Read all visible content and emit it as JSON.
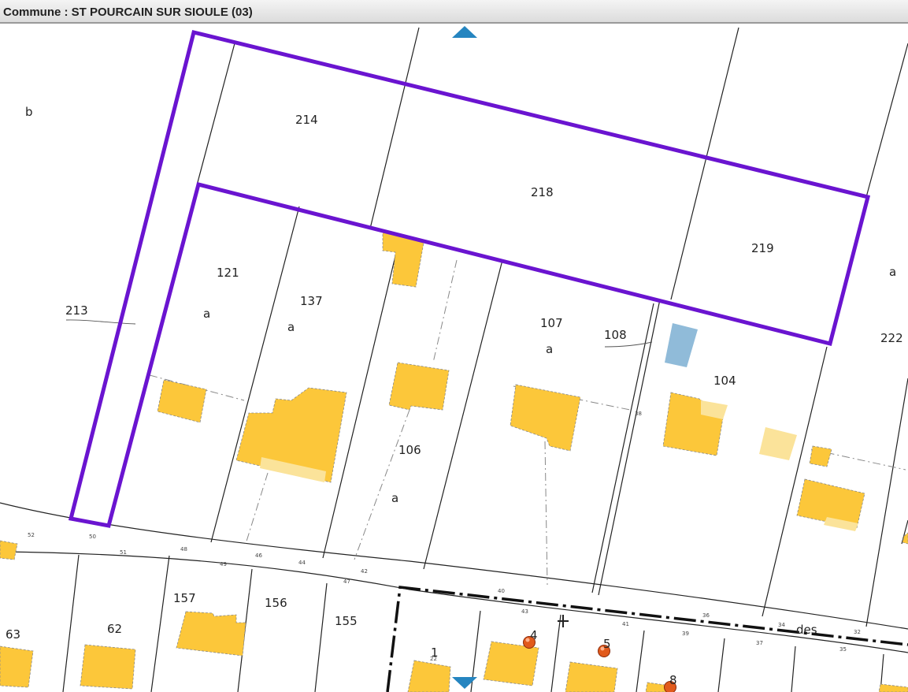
{
  "header": {
    "title": "Commune : ST POURCAIN SUR SIOULE (03)"
  },
  "colors": {
    "selection": "#6a14d0",
    "building": "#fcc73a",
    "building_light": "#fbe39a",
    "water": "#90bbd9",
    "nav_arrow": "#2585c0"
  },
  "parcels": {
    "p214": "214",
    "p218": "218",
    "p219": "219",
    "p121": "121",
    "p137": "137",
    "p107": "107",
    "p108": "108",
    "p104": "104",
    "p106": "106",
    "p213": "213",
    "p222": "222",
    "p157": "157",
    "p156": "156",
    "p155": "155",
    "p63": "63",
    "p62": "62"
  },
  "section_letters": {
    "b": "b",
    "a1": "a",
    "a2": "a",
    "a3": "a",
    "a4": "a",
    "a5": "a"
  },
  "street": {
    "label": "des"
  },
  "address_numbers": {
    "n1": "1",
    "n4": "4",
    "n5": "5",
    "n8": "8",
    "s52": "52",
    "s50": "50",
    "s51": "51",
    "s48": "48",
    "s49": "49",
    "s46": "46",
    "s44": "44",
    "s47": "47",
    "s42": "42",
    "s40": "40",
    "s43": "43",
    "s41": "41",
    "s39": "39",
    "s36": "36",
    "s37": "37",
    "s34": "34",
    "s32": "32",
    "s35": "35",
    "s38": "38",
    "s22": "22"
  },
  "navigation": {
    "up_icon": "arrow-up-icon",
    "down_icon": "arrow-down-icon"
  }
}
